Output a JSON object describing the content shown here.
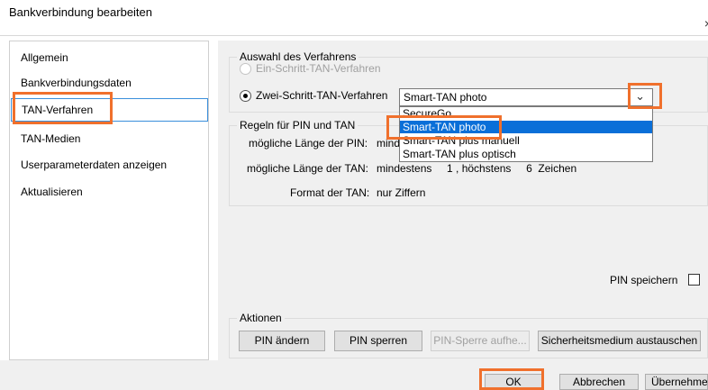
{
  "window": {
    "title": "Bankverbindung bearbeiten",
    "close_glyph": "×"
  },
  "sidebar": {
    "items": [
      {
        "label": "Allgemein"
      },
      {
        "label": "Bankverbindungsdaten"
      },
      {
        "label": "TAN-Verfahren",
        "selected": true
      },
      {
        "label": "TAN-Medien"
      },
      {
        "label": "Userparameterdaten anzeigen"
      },
      {
        "label": "Aktualisieren"
      }
    ]
  },
  "verfahren": {
    "legend": "Auswahl des Verfahrens",
    "option1": "Ein-Schritt-TAN-Verfahren",
    "option2": "Zwei-Schritt-TAN-Verfahren",
    "selected_value": "Smart-TAN photo",
    "dropdown_options": [
      "SecureGo",
      "Smart-TAN photo",
      "Smart-TAN plus manuell",
      "Smart-TAN plus optisch"
    ]
  },
  "regeln": {
    "legend": "Regeln für PIN und TAN",
    "pin_length_label": "mögliche Länge der PIN:",
    "pin_length_value": "mind",
    "tan_length_label": "mögliche Länge der TAN:",
    "tan_length_value": "mindestens     1 , höchstens     6  Zeichen",
    "tan_format_label": "Format der TAN:",
    "tan_format_value": "nur Ziffern"
  },
  "pin_speichern": {
    "label": "PIN speichern",
    "checked": false
  },
  "aktionen": {
    "legend": "Aktionen",
    "buttons": [
      "PIN ändern",
      "PIN sperren",
      "PIN-Sperre aufhe...",
      "Sicherheitsmedium austauschen"
    ]
  },
  "footer": {
    "ok": "OK",
    "cancel": "Abbrechen",
    "apply": "Übernehmen"
  },
  "colors": {
    "highlight": "#f0702c",
    "selection_blue": "#0a6fd8"
  }
}
